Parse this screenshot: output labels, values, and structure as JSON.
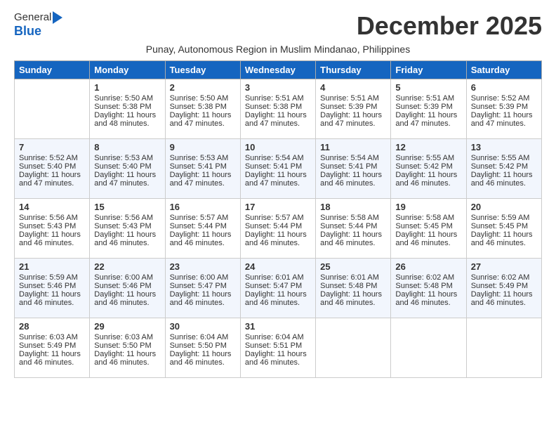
{
  "logo": {
    "general": "General",
    "blue": "Blue"
  },
  "title": "December 2025",
  "subtitle": "Punay, Autonomous Region in Muslim Mindanao, Philippines",
  "days_of_week": [
    "Sunday",
    "Monday",
    "Tuesday",
    "Wednesday",
    "Thursday",
    "Friday",
    "Saturday"
  ],
  "weeks": [
    [
      {
        "day": "",
        "info": ""
      },
      {
        "day": "1",
        "info": "Sunrise: 5:50 AM\nSunset: 5:38 PM\nDaylight: 11 hours\nand 48 minutes."
      },
      {
        "day": "2",
        "info": "Sunrise: 5:50 AM\nSunset: 5:38 PM\nDaylight: 11 hours\nand 47 minutes."
      },
      {
        "day": "3",
        "info": "Sunrise: 5:51 AM\nSunset: 5:38 PM\nDaylight: 11 hours\nand 47 minutes."
      },
      {
        "day": "4",
        "info": "Sunrise: 5:51 AM\nSunset: 5:39 PM\nDaylight: 11 hours\nand 47 minutes."
      },
      {
        "day": "5",
        "info": "Sunrise: 5:51 AM\nSunset: 5:39 PM\nDaylight: 11 hours\nand 47 minutes."
      },
      {
        "day": "6",
        "info": "Sunrise: 5:52 AM\nSunset: 5:39 PM\nDaylight: 11 hours\nand 47 minutes."
      }
    ],
    [
      {
        "day": "7",
        "info": "Sunrise: 5:52 AM\nSunset: 5:40 PM\nDaylight: 11 hours\nand 47 minutes."
      },
      {
        "day": "8",
        "info": "Sunrise: 5:53 AM\nSunset: 5:40 PM\nDaylight: 11 hours\nand 47 minutes."
      },
      {
        "day": "9",
        "info": "Sunrise: 5:53 AM\nSunset: 5:41 PM\nDaylight: 11 hours\nand 47 minutes."
      },
      {
        "day": "10",
        "info": "Sunrise: 5:54 AM\nSunset: 5:41 PM\nDaylight: 11 hours\nand 47 minutes."
      },
      {
        "day": "11",
        "info": "Sunrise: 5:54 AM\nSunset: 5:41 PM\nDaylight: 11 hours\nand 46 minutes."
      },
      {
        "day": "12",
        "info": "Sunrise: 5:55 AM\nSunset: 5:42 PM\nDaylight: 11 hours\nand 46 minutes."
      },
      {
        "day": "13",
        "info": "Sunrise: 5:55 AM\nSunset: 5:42 PM\nDaylight: 11 hours\nand 46 minutes."
      }
    ],
    [
      {
        "day": "14",
        "info": "Sunrise: 5:56 AM\nSunset: 5:43 PM\nDaylight: 11 hours\nand 46 minutes."
      },
      {
        "day": "15",
        "info": "Sunrise: 5:56 AM\nSunset: 5:43 PM\nDaylight: 11 hours\nand 46 minutes."
      },
      {
        "day": "16",
        "info": "Sunrise: 5:57 AM\nSunset: 5:44 PM\nDaylight: 11 hours\nand 46 minutes."
      },
      {
        "day": "17",
        "info": "Sunrise: 5:57 AM\nSunset: 5:44 PM\nDaylight: 11 hours\nand 46 minutes."
      },
      {
        "day": "18",
        "info": "Sunrise: 5:58 AM\nSunset: 5:44 PM\nDaylight: 11 hours\nand 46 minutes."
      },
      {
        "day": "19",
        "info": "Sunrise: 5:58 AM\nSunset: 5:45 PM\nDaylight: 11 hours\nand 46 minutes."
      },
      {
        "day": "20",
        "info": "Sunrise: 5:59 AM\nSunset: 5:45 PM\nDaylight: 11 hours\nand 46 minutes."
      }
    ],
    [
      {
        "day": "21",
        "info": "Sunrise: 5:59 AM\nSunset: 5:46 PM\nDaylight: 11 hours\nand 46 minutes."
      },
      {
        "day": "22",
        "info": "Sunrise: 6:00 AM\nSunset: 5:46 PM\nDaylight: 11 hours\nand 46 minutes."
      },
      {
        "day": "23",
        "info": "Sunrise: 6:00 AM\nSunset: 5:47 PM\nDaylight: 11 hours\nand 46 minutes."
      },
      {
        "day": "24",
        "info": "Sunrise: 6:01 AM\nSunset: 5:47 PM\nDaylight: 11 hours\nand 46 minutes."
      },
      {
        "day": "25",
        "info": "Sunrise: 6:01 AM\nSunset: 5:48 PM\nDaylight: 11 hours\nand 46 minutes."
      },
      {
        "day": "26",
        "info": "Sunrise: 6:02 AM\nSunset: 5:48 PM\nDaylight: 11 hours\nand 46 minutes."
      },
      {
        "day": "27",
        "info": "Sunrise: 6:02 AM\nSunset: 5:49 PM\nDaylight: 11 hours\nand 46 minutes."
      }
    ],
    [
      {
        "day": "28",
        "info": "Sunrise: 6:03 AM\nSunset: 5:49 PM\nDaylight: 11 hours\nand 46 minutes."
      },
      {
        "day": "29",
        "info": "Sunrise: 6:03 AM\nSunset: 5:50 PM\nDaylight: 11 hours\nand 46 minutes."
      },
      {
        "day": "30",
        "info": "Sunrise: 6:04 AM\nSunset: 5:50 PM\nDaylight: 11 hours\nand 46 minutes."
      },
      {
        "day": "31",
        "info": "Sunrise: 6:04 AM\nSunset: 5:51 PM\nDaylight: 11 hours\nand 46 minutes."
      },
      {
        "day": "",
        "info": ""
      },
      {
        "day": "",
        "info": ""
      },
      {
        "day": "",
        "info": ""
      }
    ]
  ]
}
